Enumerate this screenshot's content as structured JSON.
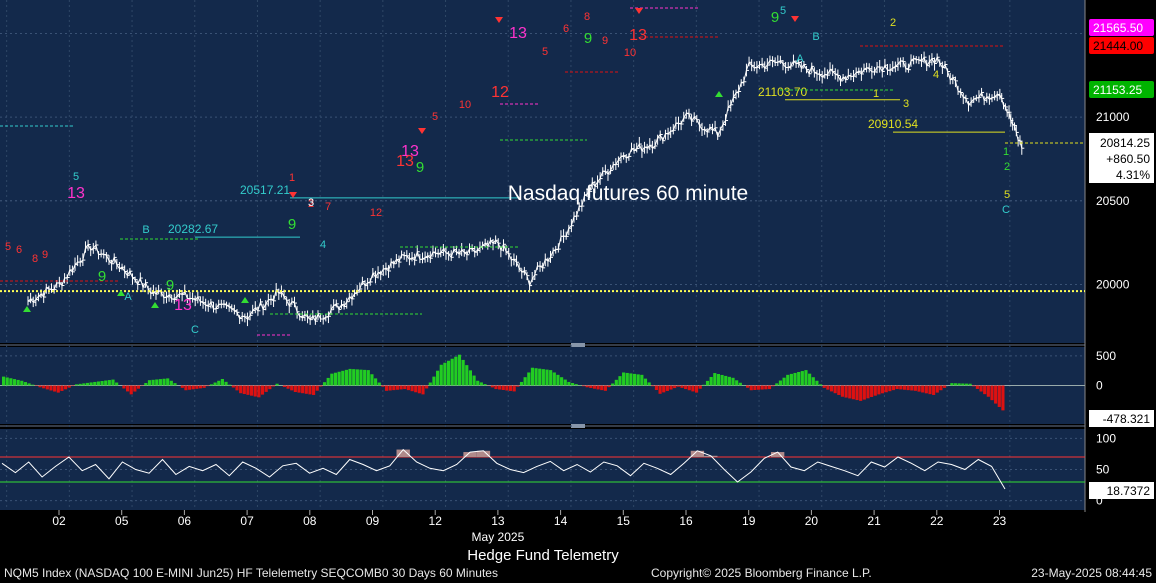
{
  "chart_data": {
    "type": "line",
    "title": "Nasdaq futures 60 minute",
    "x_axis": {
      "tick_labels": [
        "02",
        "05",
        "06",
        "07",
        "08",
        "09",
        "12",
        "13",
        "14",
        "15",
        "16",
        "19",
        "20",
        "21",
        "22",
        "23"
      ],
      "month_label": "May 2025",
      "xlabel": "Hedge Fund Telemetry"
    },
    "price_panel": {
      "ylim": [
        19650,
        21700
      ],
      "yticks": [
        20000,
        20500,
        21000
      ],
      "ytick_labels": [
        "20000",
        "20500",
        "21000"
      ],
      "series": [
        {
          "x": [
            0,
            0.5,
            1,
            1.5,
            2,
            2.5,
            3,
            3.5,
            4,
            4.5,
            5,
            5.5,
            6,
            6.5,
            7,
            7.5,
            8,
            8.5,
            9,
            9.5,
            10,
            10.5,
            11,
            11.5,
            12,
            12.5,
            13,
            13.5,
            14,
            14.5,
            15,
            15.5,
            15.85
          ],
          "values": [
            19900,
            20000,
            20230,
            20100,
            19950,
            19930,
            19870,
            19810,
            19950,
            19780,
            19880,
            20060,
            20160,
            20190,
            20180,
            20250,
            20020,
            20260,
            20590,
            20780,
            20850,
            21000,
            20900,
            21300,
            21330,
            21280,
            21240,
            21300,
            21310,
            21350,
            21100,
            21150,
            20814.25
          ]
        }
      ],
      "price_labels": [
        {
          "text": "21565.50",
          "value": 21565.5,
          "bg": "#ff00ff",
          "fg": "#ffffff"
        },
        {
          "text": "21444.00",
          "value": 21444.0,
          "bg": "#ff0000",
          "fg": "#000000"
        },
        {
          "text": "21153.25",
          "value": 21153.25,
          "bg": "#00b400",
          "fg": "#ffffff"
        }
      ],
      "current": {
        "price": "20814.25",
        "change": "+860.50",
        "pct": "4.31%"
      },
      "reference_levels": [
        {
          "value": 20517.21,
          "label": "20517.21",
          "color": "#33cccc"
        },
        {
          "value": 20282.67,
          "label": "20282.67",
          "color": "#33cccc"
        },
        {
          "value": 21103.7,
          "label": "21103.70",
          "color": "#e0e020"
        },
        {
          "value": 20910.54,
          "label": "20910.54",
          "color": "#e0e020"
        },
        {
          "value": 19960,
          "label": "",
          "color": "#ffff55"
        }
      ],
      "markers_right": [
        "1",
        "2",
        "5",
        "C"
      ]
    },
    "momentum_panel": {
      "ylim": [
        -650,
        650
      ],
      "yticks": [
        500,
        0
      ],
      "ytick_labels": [
        "500",
        "0"
      ],
      "last_value": "-478.321",
      "values": [
        150,
        80,
        -30,
        -120,
        20,
        60,
        100,
        -150,
        90,
        120,
        -80,
        -40,
        110,
        -130,
        -200,
        30,
        -110,
        -160,
        200,
        280,
        260,
        -90,
        -60,
        -150,
        350,
        520,
        80,
        -60,
        -100,
        300,
        260,
        60,
        -30,
        -90,
        220,
        180,
        -140,
        -20,
        -120,
        210,
        130,
        -80,
        -60,
        180,
        260,
        -40,
        -190,
        -260,
        -150,
        -60,
        -90,
        -160,
        40,
        30,
        -190,
        -478
      ]
    },
    "oscillator_panel": {
      "ylim": [
        -15,
        115
      ],
      "yticks": [
        100,
        50,
        0
      ],
      "ytick_labels": [
        "100",
        "50",
        "0"
      ],
      "upper_band": 70,
      "lower_band": 30,
      "last_value": "18.7372",
      "values": [
        60,
        45,
        62,
        38,
        55,
        70,
        48,
        58,
        35,
        62,
        50,
        44,
        66,
        42,
        55,
        48,
        58,
        40,
        62,
        52,
        38,
        56,
        60,
        44,
        52,
        42,
        66,
        58,
        48,
        56,
        82,
        62,
        52,
        48,
        58,
        78,
        80,
        60,
        50,
        45,
        55,
        63,
        48,
        58,
        46,
        62,
        56,
        40,
        60,
        52,
        42,
        60,
        80,
        72,
        50,
        30,
        46,
        68,
        78,
        54,
        48,
        62,
        55,
        48,
        40,
        62,
        54,
        70,
        60,
        48,
        62,
        58,
        50,
        66,
        55,
        18.7
      ]
    },
    "footer": {
      "ticker_desc": "NQM5 Index (NASDAQ 100 E-MINI Jun25) HF Telelemetry SEQCOMB0 30 Days 60 Minutes",
      "copyright": "Copyright© 2025 Bloomberg Finance L.P.",
      "timestamp": "23-May-2025 08:44:45"
    },
    "colors": {
      "plot_bg": "#13294b",
      "up": "#22cc22",
      "down": "#dd1111",
      "magenta": "#ff33cc",
      "cyan": "#33cccc",
      "yellow": "#e0e020"
    }
  }
}
